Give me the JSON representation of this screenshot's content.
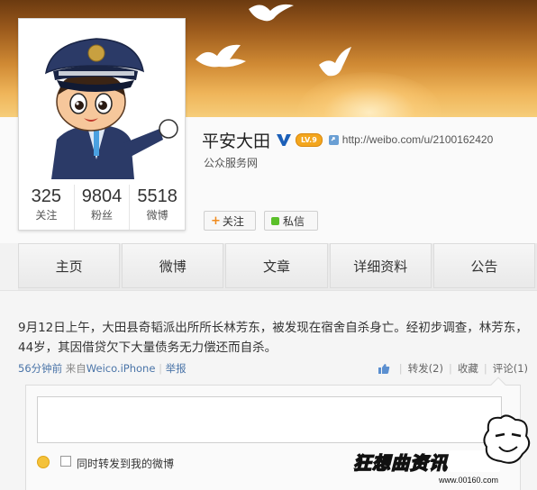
{
  "profile": {
    "name": "平安大田",
    "level": "LV.9",
    "url": "http://weibo.com/u/2100162420",
    "category": "公众服务网",
    "stats": [
      {
        "value": "325",
        "label": "关注"
      },
      {
        "value": "9804",
        "label": "粉丝"
      },
      {
        "value": "5518",
        "label": "微博"
      }
    ],
    "follow_label": "关注",
    "message_label": "私信"
  },
  "tabs": [
    "主页",
    "微博",
    "文章",
    "详细资料",
    "公告"
  ],
  "post": {
    "text": "9月12日上午，大田县奇韬派出所所长林芳东，被发现在宿舍自杀身亡。经初步调查，林芳东，44岁，其因借贷欠下大量债务无力偿还而自杀。",
    "time": "56分钟前",
    "source_prefix": "来自",
    "source": "Weico.iPhone",
    "report": "举报",
    "repost_label": "转发(2)",
    "favorite_label": "收藏",
    "comment_label": "评论(1)"
  },
  "comment": {
    "repost_checkbox_label": "同时转发到我的微博"
  },
  "watermark": {
    "text": "狂想曲资讯",
    "url": "www.00160.com"
  },
  "colors": {
    "accent_orange": "#f08a1c",
    "link_blue": "#4a74a8",
    "verified_blue": "#1b5fb8",
    "level_badge": "#f3a61e"
  }
}
